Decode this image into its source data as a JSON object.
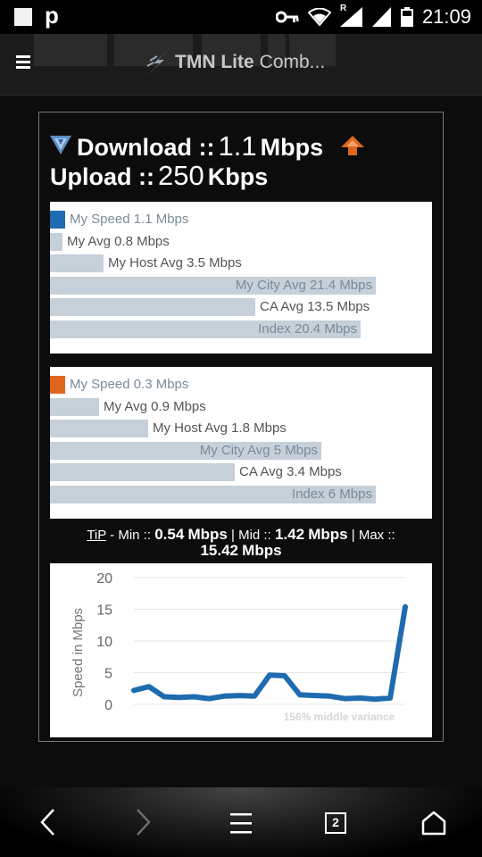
{
  "status_bar": {
    "time": "21:09",
    "app_letter": "p",
    "signal_tag": "R"
  },
  "app_bar": {
    "title": "TMN Lite",
    "subtitle": "Comb..."
  },
  "summary": {
    "download_label": "Download ::",
    "download_value": "1.1",
    "download_unit": "Mbps",
    "upload_label": "Upload ::",
    "upload_value": "250",
    "upload_unit": "Kbps"
  },
  "download_chart": {
    "bars": [
      {
        "label": "My Speed 1.1 Mbps",
        "value": 1.1
      },
      {
        "label": "My Avg 0.8 Mbps",
        "value": 0.8
      },
      {
        "label": "My Host Avg 3.5 Mbps",
        "value": 3.5
      },
      {
        "label": "My City Avg 21.4 Mbps",
        "value": 21.4
      },
      {
        "label": "CA Avg 13.5 Mbps",
        "value": 13.5
      },
      {
        "label": "Index 20.4 Mbps",
        "value": 20.4
      }
    ],
    "accent": "#1f6bb0"
  },
  "upload_chart": {
    "bars": [
      {
        "label": "My Speed 0.3 Mbps",
        "value": 0.3
      },
      {
        "label": "My Avg 0.9 Mbps",
        "value": 0.9
      },
      {
        "label": "My Host Avg 1.8 Mbps",
        "value": 1.8
      },
      {
        "label": "My City Avg 5 Mbps",
        "value": 5
      },
      {
        "label": "CA Avg 3.4 Mbps",
        "value": 3.4
      },
      {
        "label": "Index 6 Mbps",
        "value": 6
      }
    ],
    "accent": "#e0661f"
  },
  "tip": {
    "label": "TiP",
    "min_label": "- Min ::",
    "min_value": "0.54",
    "mid_label": "| Mid ::",
    "mid_value": "1.42",
    "max_label": "| Max ::",
    "max_value": "15.42",
    "unit": "Mbps"
  },
  "line_chart": {
    "ylabel": "Speed in Mbps",
    "yticks": [
      0,
      5,
      10,
      15,
      20
    ],
    "ylim": [
      0,
      20
    ],
    "values": [
      2.2,
      2.8,
      1.2,
      1.1,
      1.2,
      0.9,
      1.3,
      1.4,
      1.3,
      4.6,
      4.5,
      1.5,
      1.4,
      1.3,
      0.9,
      1.0,
      0.8,
      1.0,
      15.4
    ],
    "annotation": "156% middle variance",
    "line_color": "#1f6bb0"
  },
  "chart_data": {
    "type": "line",
    "ylabel": "Speed in Mbps",
    "ylim": [
      0,
      20
    ],
    "yticks": [
      0,
      5,
      10,
      15,
      20
    ],
    "series": [
      {
        "values": [
          2.2,
          2.8,
          1.2,
          1.1,
          1.2,
          0.9,
          1.3,
          1.4,
          1.3,
          4.6,
          4.5,
          1.5,
          1.4,
          1.3,
          0.9,
          1.0,
          0.8,
          1.0,
          15.4
        ]
      }
    ],
    "annotations": [
      "156% middle variance"
    ]
  },
  "nav_bar": {
    "tab_count": "2"
  }
}
